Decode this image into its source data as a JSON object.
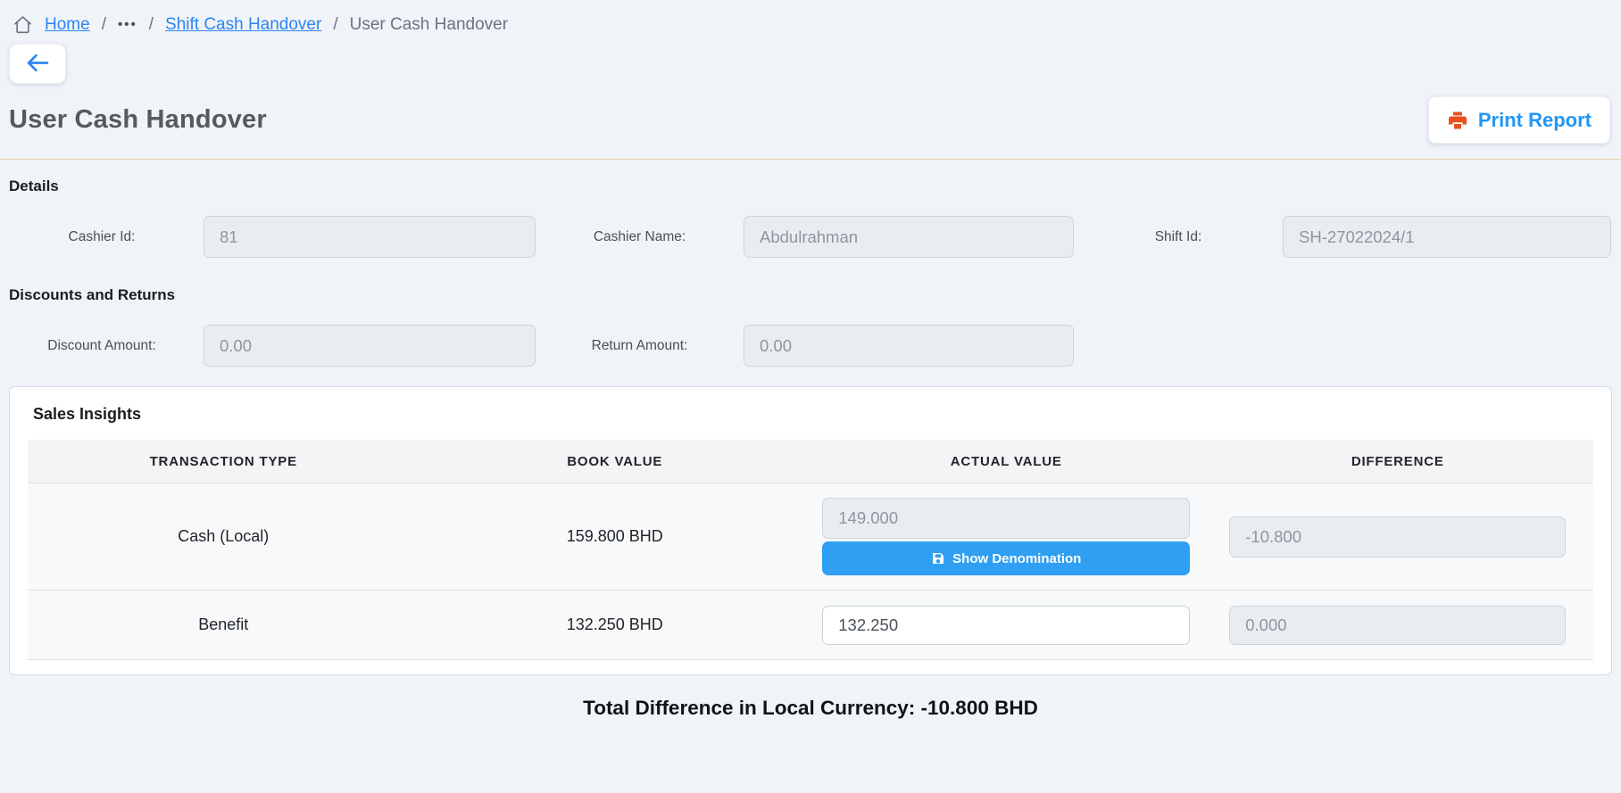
{
  "breadcrumb": {
    "home_label": "Home",
    "separator": "/",
    "ellipsis_label": "•••",
    "shift_label": "Shift Cash Handover",
    "current_label": "User Cash Handover"
  },
  "header": {
    "title": "User Cash Handover",
    "print_label": "Print Report"
  },
  "details": {
    "section_title": "Details",
    "fields": [
      {
        "label": "Cashier Id:",
        "value": "81"
      },
      {
        "label": "Cashier Name:",
        "value": "Abdulrahman"
      },
      {
        "label": "Shift Id:",
        "value": "SH-27022024/1"
      }
    ]
  },
  "discounts": {
    "section_title": "Discounts and Returns",
    "fields": [
      {
        "label": "Discount Amount:",
        "value": "0.00"
      },
      {
        "label": "Return Amount:",
        "value": "0.00"
      }
    ]
  },
  "sales_insights": {
    "section_title": "Sales Insights",
    "columns": [
      "Transaction Type",
      "Book Value",
      "Actual Value",
      "Difference"
    ],
    "rows": [
      {
        "transaction_type": "Cash (Local)",
        "book_value": "159.800 BHD",
        "actual_value": "149.000",
        "show_denomination_label": "Show Denomination",
        "difference": "-10.800"
      },
      {
        "transaction_type": "Benefit",
        "book_value": "132.250 BHD",
        "actual_value": "132.250",
        "difference": "0.000"
      }
    ]
  },
  "footer": {
    "total_difference": "Total Difference in Local Currency: -10.800 BHD"
  },
  "colors": {
    "page_background": "#f0f3f8",
    "link_blue": "#2b85f2",
    "print_text_blue": "#2196f3",
    "printer_orange": "#ea501f",
    "denomination_button_blue": "#2f9ef3",
    "divider_orange": "#f1d2ae",
    "disabled_input_bg": "#e9edf2"
  }
}
